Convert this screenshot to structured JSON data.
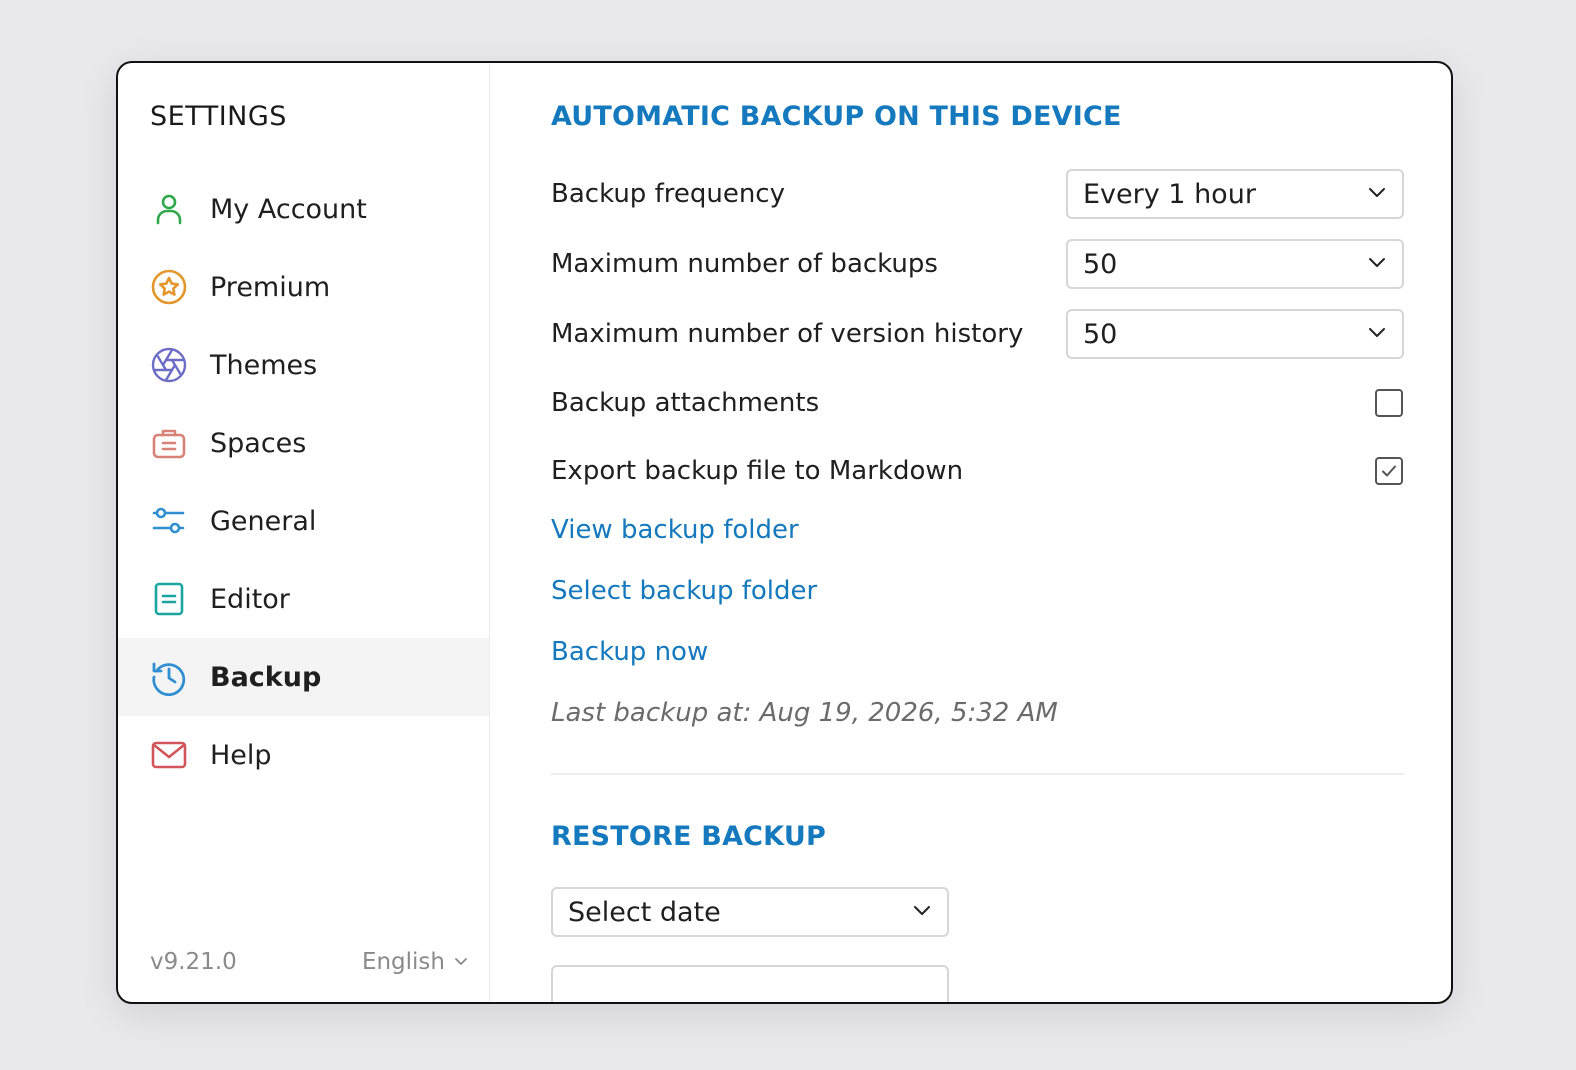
{
  "sidebar": {
    "title": "SETTINGS",
    "items": [
      {
        "label": "My Account",
        "icon": "user-icon",
        "color": "#2ea84a"
      },
      {
        "label": "Premium",
        "icon": "star-icon",
        "color": "#e3962b"
      },
      {
        "label": "Themes",
        "icon": "aperture-icon",
        "color": "#6e6dc6"
      },
      {
        "label": "Spaces",
        "icon": "briefcase-icon",
        "color": "#d9827a"
      },
      {
        "label": "General",
        "icon": "sliders-icon",
        "color": "#2f8fd1"
      },
      {
        "label": "Editor",
        "icon": "document-icon",
        "color": "#1aa6a0"
      },
      {
        "label": "Backup",
        "icon": "history-icon",
        "color": "#2f8fd1",
        "active": true
      },
      {
        "label": "Help",
        "icon": "mail-icon",
        "color": "#d2555b"
      }
    ],
    "version": "v9.21.0",
    "language": "English"
  },
  "backup": {
    "section_title": "AUTOMATIC BACKUP ON THIS DEVICE",
    "frequency_label": "Backup frequency",
    "frequency_value": "Every 1 hour",
    "max_backups_label": "Maximum number of backups",
    "max_backups_value": "50",
    "max_history_label": "Maximum number of version history",
    "max_history_value": "50",
    "attachments_label": "Backup attachments",
    "attachments_checked": false,
    "markdown_label": "Export backup file to Markdown",
    "markdown_checked": true,
    "view_folder_link": "View backup folder",
    "select_folder_link": "Select backup folder",
    "backup_now_link": "Backup now",
    "last_backup": "Last backup at: Aug 19, 2026, 5:32 AM"
  },
  "restore": {
    "section_title": "RESTORE BACKUP",
    "date_select_value": "Select date"
  },
  "colors": {
    "accent": "#1479bd",
    "active_bg": "#f4f4f5"
  }
}
